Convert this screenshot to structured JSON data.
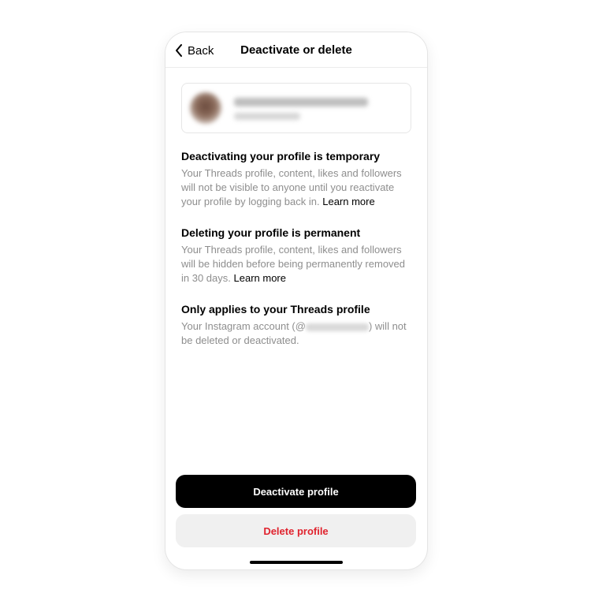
{
  "nav": {
    "back_label": "Back",
    "title": "Deactivate or delete"
  },
  "sections": [
    {
      "title": "Deactivating your profile is temporary",
      "body": "Your Threads profile, content, likes and followers will not be visible to anyone until you reactivate your profile by logging back in.",
      "link": "Learn more"
    },
    {
      "title": "Deleting your profile is permanent",
      "body": "Your Threads profile, content, likes and followers will be hidden before being permanently removed in 30 days.",
      "link": "Learn more"
    },
    {
      "title": "Only applies to your Threads profile",
      "body_prefix": "Your Instagram account (@",
      "body_suffix": ") will not be deleted or deactivated."
    }
  ],
  "buttons": {
    "deactivate": "Deactivate profile",
    "delete": "Delete profile"
  },
  "colors": {
    "primary_button_bg": "#000000",
    "delete_text": "#e0232e",
    "secondary_text": "#8e8e8e"
  },
  "icons": {
    "back": "chevron-left-icon"
  }
}
